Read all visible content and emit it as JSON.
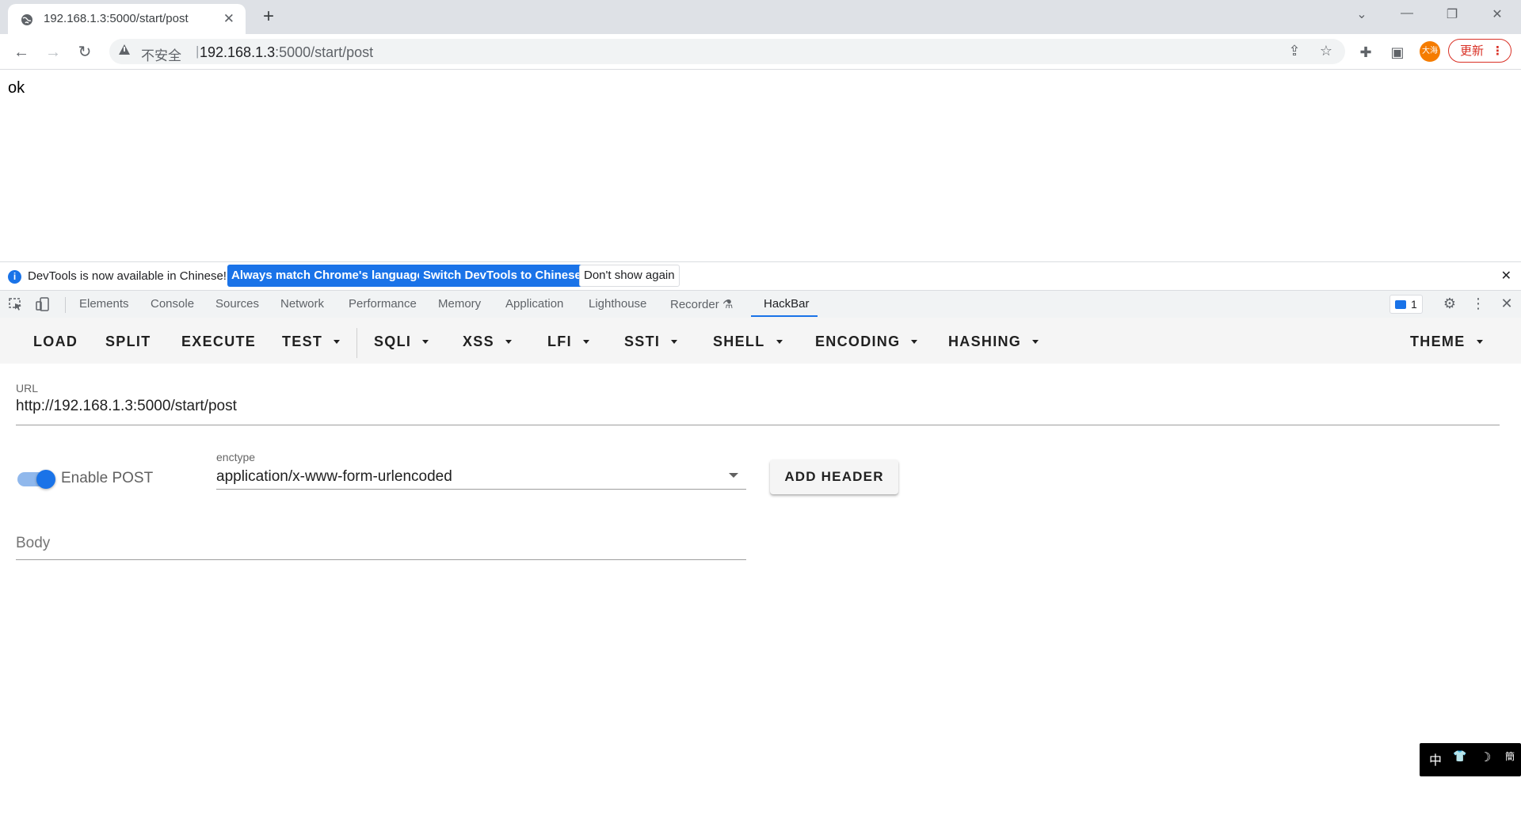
{
  "tab": {
    "title": "192.168.1.3:5000/start/post",
    "favicon": "globe-icon",
    "close": "✕"
  },
  "new_tab": "+",
  "window_controls": {
    "dropdown": "⌄",
    "minimize": "—",
    "restore": "❐",
    "close": "✕"
  },
  "nav": {
    "back": "←",
    "forward": "→",
    "reload": "↻"
  },
  "address": {
    "security_label": "不安全",
    "separator": "|",
    "url_host": "192.168.1.3",
    "url_rest": ":5000/start/post",
    "share_icon": "⇪",
    "bookmark_icon": "☆"
  },
  "extensions": {
    "puzzle_icon": "✚",
    "sidepanel_icon": "▣"
  },
  "profile": {
    "avatar_text": "大海",
    "update_label": "更新",
    "menu_dots": "⋮"
  },
  "page": {
    "text": "ok"
  },
  "infobar": {
    "icon": "i",
    "message": "DevTools is now available in Chinese!",
    "btn_match": "Always match Chrome's language",
    "btn_switch": "Switch DevTools to Chinese",
    "btn_dismiss": "Don't show again",
    "close": "✕"
  },
  "devtools": {
    "tabs": [
      "Elements",
      "Console",
      "Sources",
      "Network",
      "Performance",
      "Memory",
      "Application",
      "Lighthouse",
      "Recorder ⚗",
      "HackBar"
    ],
    "active_tab": "HackBar",
    "issues_count": "1",
    "settings_icon": "⚙",
    "more_icon": "⋮",
    "close_icon": "✕"
  },
  "hackbar": {
    "toolbar": {
      "load": "LOAD",
      "split": "SPLIT",
      "execute": "EXECUTE",
      "test": "TEST",
      "sqli": "SQLI",
      "xss": "XSS",
      "lfi": "LFI",
      "ssti": "SSTI",
      "shell": "SHELL",
      "encoding": "ENCODING",
      "hashing": "HASHING",
      "theme": "THEME"
    },
    "url_label": "URL",
    "url_value": "http://192.168.1.3:5000/start/post",
    "enable_post_label": "Enable POST",
    "enable_post_on": true,
    "enctype_label": "enctype",
    "enctype_value": "application/x-www-form-urlencoded",
    "add_header": "ADD HEADER",
    "body_placeholder": "Body"
  },
  "ime": {
    "lang": "中",
    "shirt": "👕",
    "moon": "☽",
    "extra": "簡"
  },
  "colors": {
    "accent": "#1a73e8",
    "update_red": "#d93025",
    "avatar_orange": "#f57c00"
  }
}
